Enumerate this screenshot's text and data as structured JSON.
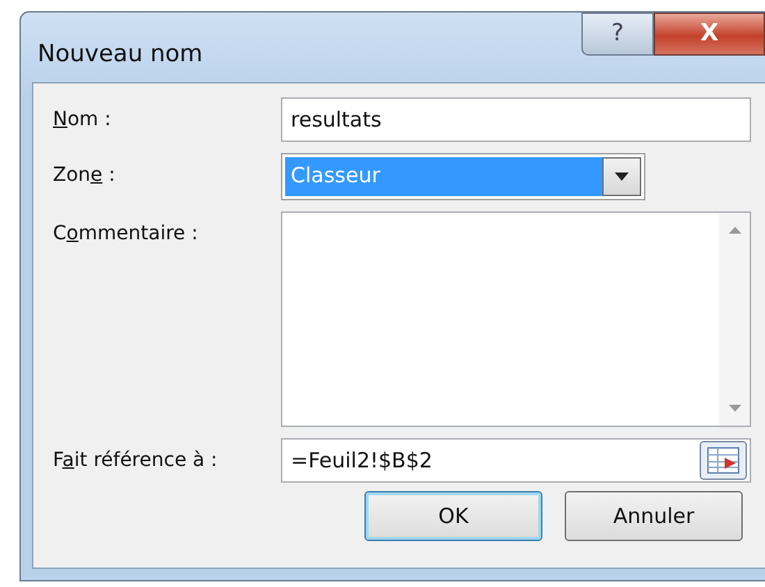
{
  "window": {
    "title": "Nouveau nom",
    "help_glyph": "?",
    "close_glyph": "X"
  },
  "fields": [
    {
      "kind": "text",
      "label": {
        "key": "N",
        "after": "om :"
      },
      "value": "resultats"
    },
    {
      "kind": "combo",
      "label": {
        "before": "Zon",
        "key": "e",
        "after": " :"
      },
      "value": "Classeur",
      "selected": true
    },
    {
      "kind": "memo",
      "label": {
        "before": "C",
        "key": "o",
        "after": "mmentaire :"
      }
    },
    {
      "kind": "ref",
      "label": {
        "before": "F",
        "key": "a",
        "after": "it référence à :"
      },
      "value": "=Feuil2!$B$2"
    }
  ],
  "buttons": [
    {
      "label": "OK",
      "default": true
    },
    {
      "label": "Annuler",
      "default": false
    }
  ]
}
